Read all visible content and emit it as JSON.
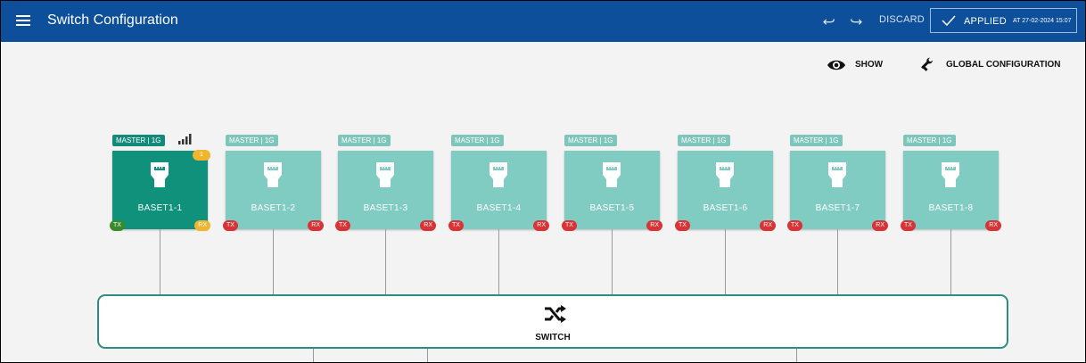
{
  "app": {
    "title": "Switch Configuration",
    "brand_color": "#0d4f9a",
    "undo_icon": "undo-icon",
    "redo_icon": "redo-icon",
    "discard_label": "DISCARD",
    "applied_label": "APPLIED",
    "applied_date": "AT 27-02-2024 15:07"
  },
  "toolbar": {
    "show_label": "SHOW",
    "show_icon": "eye-icon",
    "global_label": "GLOBAL CONFIGURATION",
    "global_icon": "wrench-icon"
  },
  "ports": [
    {
      "name": "BASET1-1",
      "mode": "MASTER | 1G",
      "tx": "TX",
      "rx": "RX",
      "count": "1",
      "active": true,
      "tx_color": "#3a8a2c",
      "rx_color": "#f0b42e"
    },
    {
      "name": "BASET1-2",
      "mode": "MASTER | 1G",
      "tx": "TX",
      "rx": "RX",
      "active": false,
      "tx_color": "#d83437",
      "rx_color": "#d83437"
    },
    {
      "name": "BASET1-3",
      "mode": "MASTER | 1G",
      "tx": "TX",
      "rx": "RX",
      "active": false,
      "tx_color": "#d83437",
      "rx_color": "#d83437"
    },
    {
      "name": "BASET1-4",
      "mode": "MASTER | 1G",
      "tx": "TX",
      "rx": "RX",
      "active": false,
      "tx_color": "#d83437",
      "rx_color": "#d83437"
    },
    {
      "name": "BASET1-5",
      "mode": "MASTER | 1G",
      "tx": "TX",
      "rx": "RX",
      "active": false,
      "tx_color": "#d83437",
      "rx_color": "#d83437"
    },
    {
      "name": "BASET1-6",
      "mode": "MASTER | 1G",
      "tx": "TX",
      "rx": "RX",
      "active": false,
      "tx_color": "#d83437",
      "rx_color": "#d83437"
    },
    {
      "name": "BASET1-7",
      "mode": "MASTER | 1G",
      "tx": "TX",
      "rx": "RX",
      "active": false,
      "tx_color": "#d83437",
      "rx_color": "#d83437"
    },
    {
      "name": "BASET1-8",
      "mode": "MASTER | 1G",
      "tx": "TX",
      "rx": "RX",
      "active": false,
      "tx_color": "#d83437",
      "rx_color": "#d83437"
    }
  ],
  "switch": {
    "label": "SWITCH",
    "icon": "shuffle-icon"
  }
}
